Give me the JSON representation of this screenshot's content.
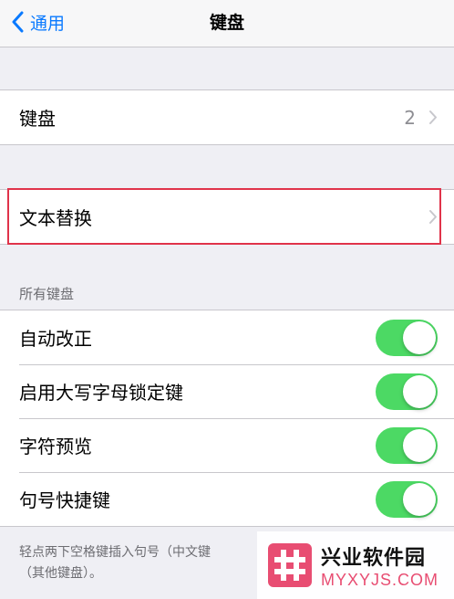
{
  "nav": {
    "back_label": "通用",
    "title": "键盘"
  },
  "keyboards_row": {
    "label": "键盘",
    "value": "2"
  },
  "text_replacement_row": {
    "label": "文本替换"
  },
  "all_keyboards": {
    "header": "所有键盘",
    "toggles": [
      {
        "label": "自动改正",
        "on": true
      },
      {
        "label": "启用大写字母锁定键",
        "on": true
      },
      {
        "label": "字符预览",
        "on": true
      },
      {
        "label": "句号快捷键",
        "on": true
      }
    ],
    "footer_line1": "轻点两下空格键插入句号（中文键",
    "footer_line2": "（其他键盘）。"
  },
  "colors": {
    "accent": "#0a7aff",
    "toggle_on": "#4cd964",
    "highlight": "#e0334a"
  },
  "watermark": {
    "title": "兴业软件园",
    "subtitle": "MYXYJS.COM"
  }
}
